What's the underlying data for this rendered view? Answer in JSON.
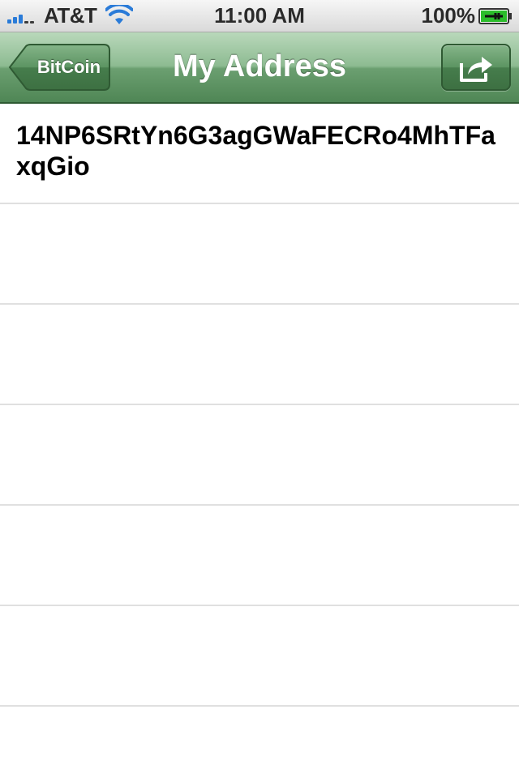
{
  "status_bar": {
    "carrier": "AT&T",
    "time": "11:00 AM",
    "battery_percent": "100%",
    "signal_bars_active": 3,
    "signal_bars_total": 5,
    "icons": [
      "signal-icon",
      "wifi-icon",
      "battery-charging-icon"
    ]
  },
  "nav_bar": {
    "back_label": "BitCoin",
    "title": "My Address",
    "action_icon": "share-icon",
    "tint_color": "#5f9665"
  },
  "address": {
    "value": "14NP6SRtYn6G3agGWaFECRo4MhTFaxqGio"
  }
}
